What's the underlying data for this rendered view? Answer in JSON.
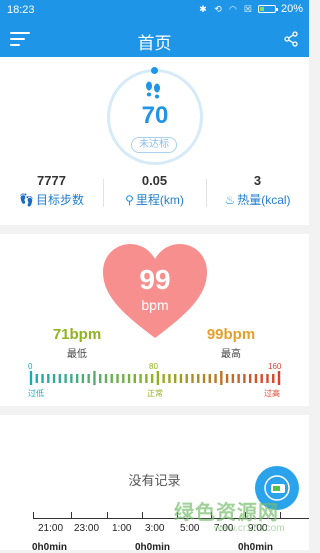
{
  "status_bar": {
    "time": "18:23",
    "battery": "20%"
  },
  "header": {
    "title": "首页"
  },
  "steps": {
    "count": "70",
    "status": "未达标",
    "stats": [
      {
        "value": "7777",
        "label": "目标步数",
        "icon": "feet-icon"
      },
      {
        "value": "0.05",
        "label": "里程(km)",
        "icon": "location-icon"
      },
      {
        "value": "3",
        "label": "热量(kcal)",
        "icon": "flame-icon"
      }
    ]
  },
  "heart_rate": {
    "value": "99",
    "unit": "bpm",
    "min_value": "71bpm",
    "min_label": "最低",
    "max_value": "99bpm",
    "max_label": "最高",
    "scale": {
      "labels": [
        "0",
        "80",
        "160"
      ],
      "zones": [
        "过低",
        "正常",
        "过高"
      ]
    },
    "colors": {
      "heart": "#f78f8f",
      "min": "#8fb31f",
      "max": "#e5a02a"
    }
  },
  "history": {
    "empty_text": "没有记录",
    "timeline_labels": [
      "21:00",
      "23:00",
      "1:00",
      "3:00",
      "5:00",
      "7:00",
      "9:00"
    ],
    "durations": [
      "0h0min",
      "0h0min",
      "0h0min"
    ]
  },
  "watermark": {
    "text": "绿色资源网",
    "sub": "www.cr173.com"
  },
  "accent": "#1e95e6"
}
